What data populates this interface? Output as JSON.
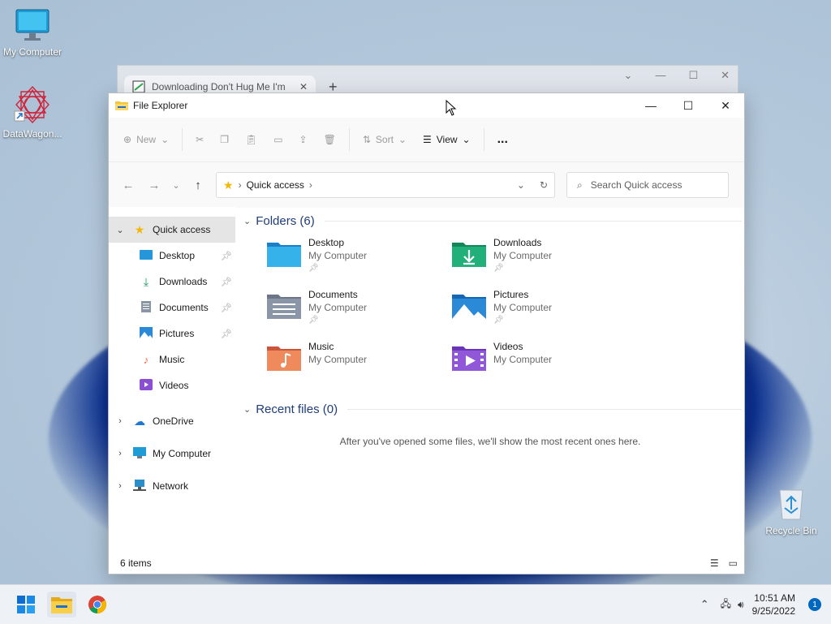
{
  "desktop": {
    "icons": [
      {
        "label": "My Computer"
      },
      {
        "label": "DataWagon..."
      },
      {
        "label": "Recycle Bin"
      }
    ]
  },
  "chrome": {
    "tab_title": "Downloading Don't Hug Me I'm"
  },
  "explorer": {
    "title": "File Explorer",
    "toolbar": {
      "new_label": "New",
      "sort_label": "Sort",
      "view_label": "View",
      "more_label": "..."
    },
    "address": {
      "location": "Quick access"
    },
    "search": {
      "placeholder": "Search Quick access"
    },
    "sidebar": {
      "quick_access": "Quick access",
      "items": [
        {
          "label": "Desktop",
          "pinned": true
        },
        {
          "label": "Downloads",
          "pinned": true
        },
        {
          "label": "Documents",
          "pinned": true
        },
        {
          "label": "Pictures",
          "pinned": true
        },
        {
          "label": "Music",
          "pinned": false
        },
        {
          "label": "Videos",
          "pinned": false
        }
      ],
      "roots": [
        {
          "label": "OneDrive"
        },
        {
          "label": "My Computer"
        },
        {
          "label": "Network"
        }
      ]
    },
    "folders_header": "Folders (6)",
    "folders": [
      {
        "name": "Desktop",
        "location": "My Computer",
        "pinned": true
      },
      {
        "name": "Downloads",
        "location": "My Computer",
        "pinned": true
      },
      {
        "name": "Documents",
        "location": "My Computer",
        "pinned": true
      },
      {
        "name": "Pictures",
        "location": "My Computer",
        "pinned": true
      },
      {
        "name": "Music",
        "location": "My Computer",
        "pinned": false
      },
      {
        "name": "Videos",
        "location": "My Computer",
        "pinned": false
      }
    ],
    "recent_header": "Recent files (0)",
    "recent_message": "After you've opened some files, we'll show the most recent ones here.",
    "status": "6 items"
  },
  "taskbar": {
    "time": "10:51 AM",
    "date": "9/25/2022",
    "notifications": "1"
  },
  "colors": {
    "accent": "#0067c0",
    "folder_yellow": "#f5c542"
  }
}
